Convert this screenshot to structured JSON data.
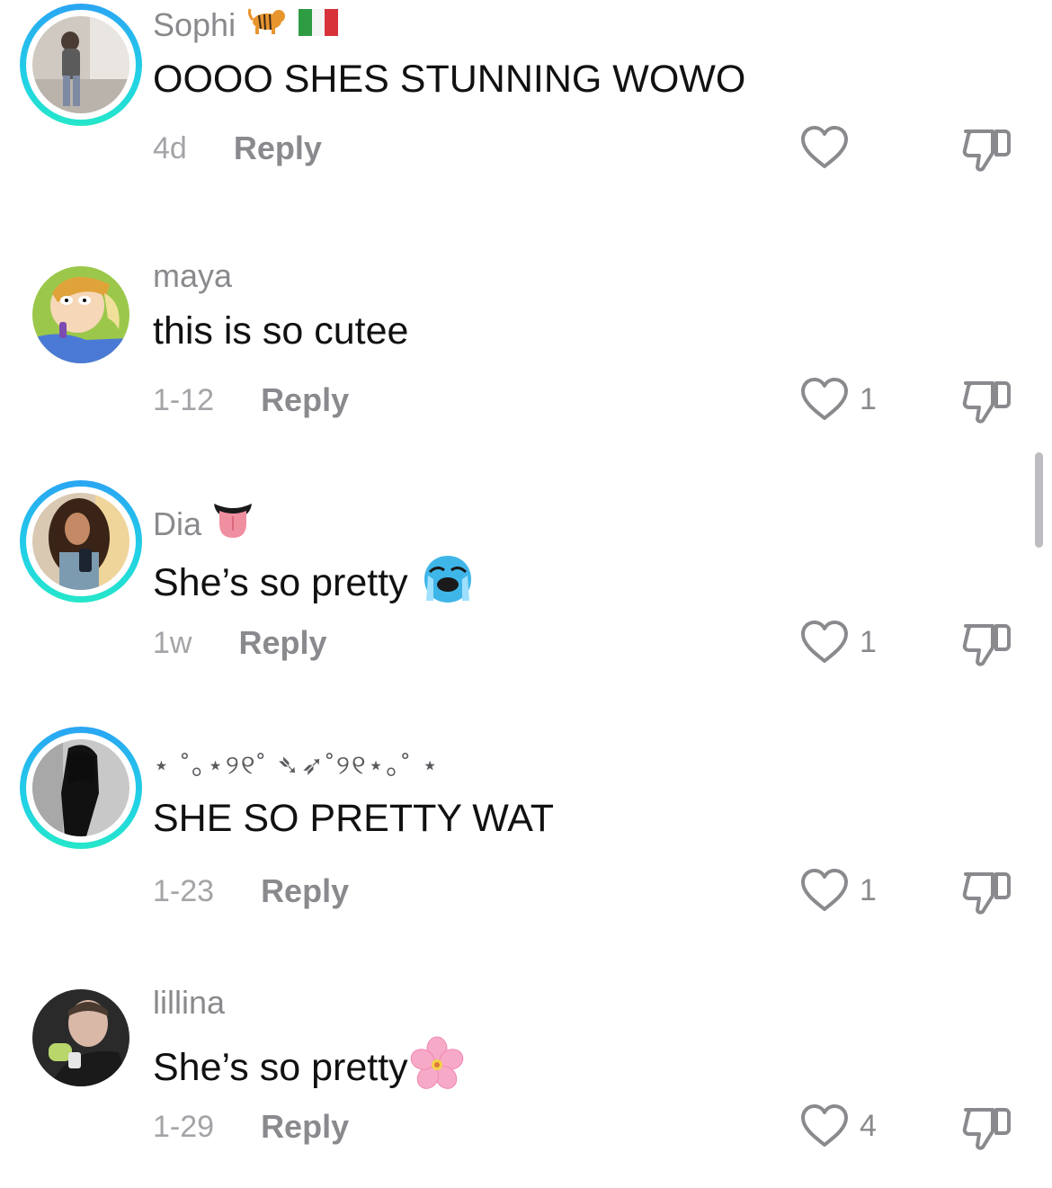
{
  "comments": [
    {
      "username": "Sophi",
      "username_emojis": [
        "tiger-emoji",
        "italy-flag-emoji"
      ],
      "text": "OOOO SHES STUNNING WOWO",
      "time": "4d",
      "reply_label": "Reply",
      "like_count": "",
      "story_ring": true
    },
    {
      "username": "maya",
      "text": "this is so cutee",
      "time": "1-12",
      "reply_label": "Reply",
      "like_count": "1",
      "story_ring": false
    },
    {
      "username": "Dia",
      "username_emojis": [
        "tongue-emoji"
      ],
      "text": "She’s so pretty",
      "text_emojis": [
        "crying-face-emoji"
      ],
      "time": "1w",
      "reply_label": "Reply",
      "like_count": "1",
      "story_ring": true
    },
    {
      "username": "⋆ ˚｡⋆୨୧˚ ➴➶˚୨୧⋆｡˚ ⋆",
      "text": "SHE SO PRETTY WAT",
      "time": "1-23",
      "reply_label": "Reply",
      "like_count": "1",
      "story_ring": true
    },
    {
      "username": "lillina",
      "text": "She’s so pretty",
      "text_emojis": [
        "cherry-blossom-emoji"
      ],
      "time": "1-29",
      "reply_label": "Reply",
      "like_count": "4",
      "story_ring": false
    }
  ],
  "icons": {
    "like": "heart-outline-icon",
    "dislike": "thumbs-down-icon"
  },
  "colors": {
    "ring_gradient_start": "#2aa5f3",
    "ring_gradient_end": "#25e7c9",
    "secondary_text": "#8a8a8e",
    "primary_text": "#111111"
  }
}
